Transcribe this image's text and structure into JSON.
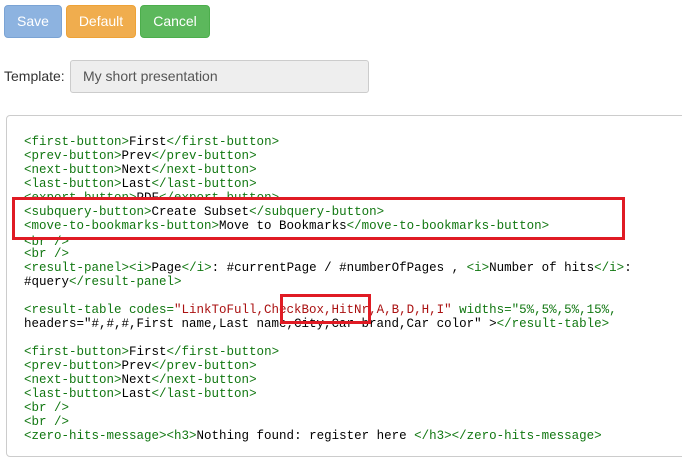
{
  "toolbar": {
    "save_label": "Save",
    "default_label": "Default",
    "cancel_label": "Cancel"
  },
  "template": {
    "label": "Template:",
    "value": "My short presentation"
  },
  "code_lines": [
    "<first-button>First</first-button>",
    "<prev-button>Prev</prev-button>",
    "<next-button>Next</next-button>",
    "<last-button>Last</last-button>",
    "<export-button>PDF</export-button>",
    "<subquery-button>Create Subset</subquery-button>",
    "<move-to-bookmarks-button>Move to Bookmarks</move-to-bookmarks-button>",
    "<br />",
    "<br />",
    "<result-panel><i>Page</i>: #currentPage / #numberOfPages , <i>Number of hits</i>:",
    "#query</result-panel>",
    "",
    "<result-table codes=\"LinkToFull,CheckBox,HitNr,A,B,D,H,I\" widths=\"5%,5%,5%,15%,",
    "headers=\"#,#,#,First name,Last name,City,Car brand,Car color\" ></result-table>",
    "",
    "<first-button>First</first-button>",
    "<prev-button>Prev</prev-button>",
    "<next-button>Next</next-button>",
    "<last-button>Last</last-button>",
    "<br />",
    "<br />",
    "<zero-hits-message><h3>Nothing found: register here </h3></zero-hits-message>"
  ],
  "colors": {
    "highlight": "#e01b24",
    "tag": "#117711",
    "text": "#000000"
  }
}
